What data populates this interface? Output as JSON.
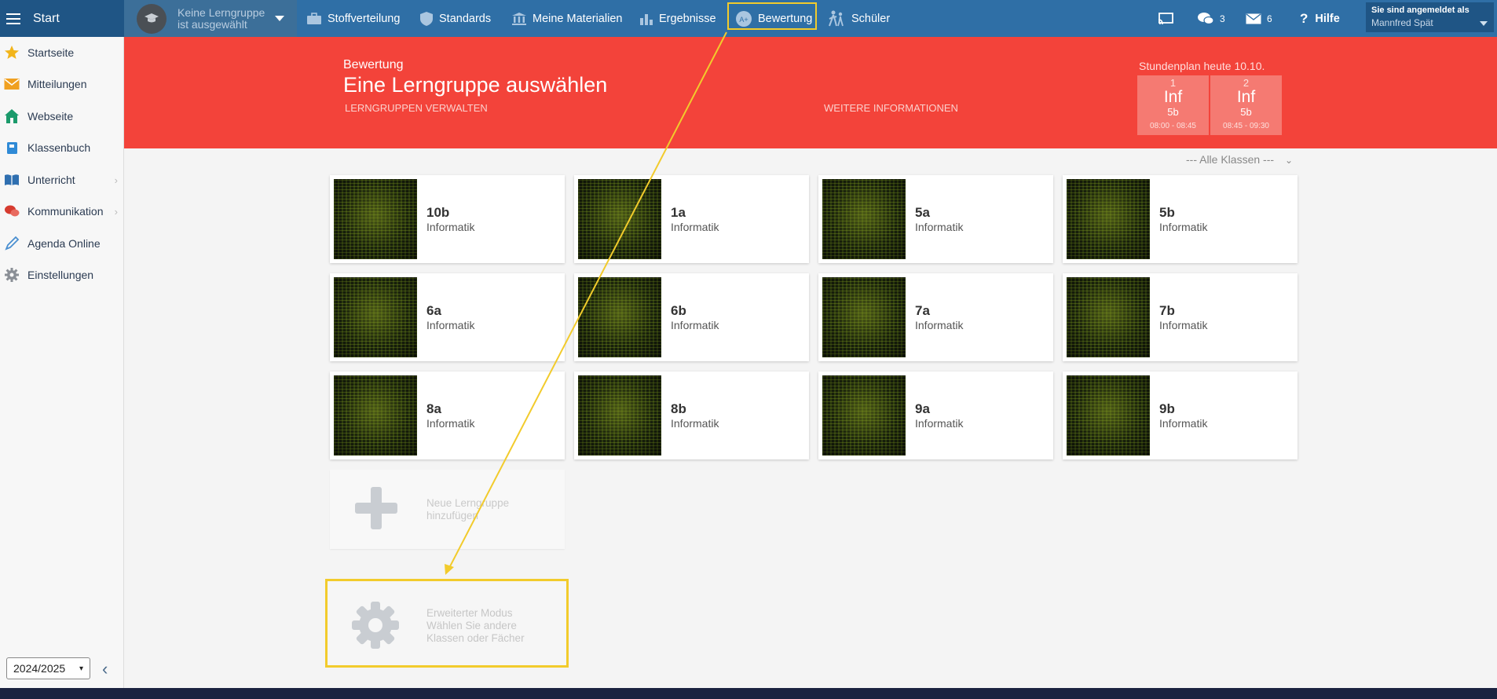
{
  "topbar": {
    "start_label": "Start",
    "lerngruppe": {
      "line1": "Keine Lerngruppe",
      "line2": "ist ausgewählt"
    },
    "nav": [
      {
        "label": "Stoffverteilung",
        "icon": "briefcase-icon"
      },
      {
        "label": "Standards",
        "icon": "shield-icon"
      },
      {
        "label": "Meine Materialien",
        "icon": "library-icon"
      },
      {
        "label": "Ergebnisse",
        "icon": "bar-chart-icon"
      },
      {
        "label": "Bewertung",
        "icon": "grading-icon",
        "highlighted": true
      },
      {
        "label": "Schüler",
        "icon": "students-icon"
      }
    ],
    "chat_count": "3",
    "mail_count": "6",
    "help_label": "Hilfe",
    "login": {
      "label": "Sie sind angemeldet als",
      "user": "Mannfred Spät"
    }
  },
  "sidebar": {
    "items": [
      {
        "label": "Startseite",
        "icon": "star-icon",
        "color": "#f2b51b"
      },
      {
        "label": "Mitteilungen",
        "icon": "envelope-icon",
        "color": "#f0a020"
      },
      {
        "label": "Webseite",
        "icon": "house-icon",
        "color": "#1b9a6b"
      },
      {
        "label": "Klassenbuch",
        "icon": "book-icon",
        "color": "#2f8ad6"
      },
      {
        "label": "Unterricht",
        "icon": "open-book-icon",
        "color": "#2f6fb0",
        "chevron": "›"
      },
      {
        "label": "Kommunikation",
        "icon": "chat-bubbles-icon",
        "color": "#d63b2f",
        "chevron": "›"
      },
      {
        "label": "Agenda Online",
        "icon": "pen-icon",
        "color": "#4a8fd0"
      },
      {
        "label": "Einstellungen",
        "icon": "gear-icon",
        "color": "#8a8f96"
      }
    ],
    "year": "2024/2025",
    "collapse": "‹"
  },
  "header": {
    "subtitle": "Bewertung",
    "title": "Eine Lerngruppe auswählen",
    "link_manage": "LERNGRUPPEN VERWALTEN",
    "link_info": "WEITERE INFORMATIONEN",
    "stundenplan_title": "Stundenplan heute 10.10.",
    "lessons": [
      {
        "num": "1",
        "subject": "Inf",
        "class": "5b",
        "time": "08:00 - 08:45"
      },
      {
        "num": "2",
        "subject": "Inf",
        "class": "5b",
        "time": "08:45 - 09:30"
      }
    ]
  },
  "filter": {
    "value": "--- Alle Klassen ---",
    "caret": "⌄"
  },
  "classes": [
    {
      "name": "10b",
      "subject": "Informatik"
    },
    {
      "name": "1a",
      "subject": "Informatik"
    },
    {
      "name": "5a",
      "subject": "Informatik"
    },
    {
      "name": "5b",
      "subject": "Informatik"
    },
    {
      "name": "6a",
      "subject": "Informatik"
    },
    {
      "name": "6b",
      "subject": "Informatik"
    },
    {
      "name": "7a",
      "subject": "Informatik"
    },
    {
      "name": "7b",
      "subject": "Informatik"
    },
    {
      "name": "8a",
      "subject": "Informatik"
    },
    {
      "name": "8b",
      "subject": "Informatik"
    },
    {
      "name": "9a",
      "subject": "Informatik"
    },
    {
      "name": "9b",
      "subject": "Informatik"
    }
  ],
  "add_group": {
    "line1": "Neue Lerngruppe",
    "line2": "hinzufügen"
  },
  "extended": {
    "line1": "Erweiterter Modus",
    "line2": "Wählen Sie andere",
    "line3": "Klassen oder Fächer"
  },
  "colors": {
    "topbar": "#2f6fa6",
    "banner": "#f3433a",
    "highlight": "#f2cb2c"
  }
}
